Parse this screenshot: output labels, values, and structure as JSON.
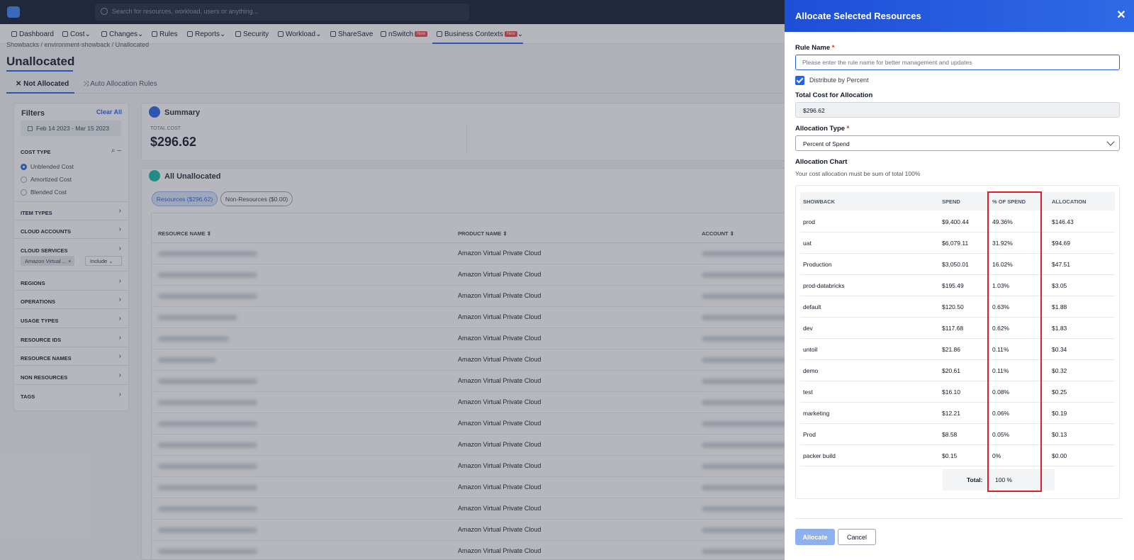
{
  "app": {
    "search_placeholder": "Search for resources, workload, users or anything..."
  },
  "nav": {
    "items": [
      {
        "label": "Dashboard",
        "icon": "grid-icon"
      },
      {
        "label": "Cost",
        "icon": "dollar-icon",
        "caret": "⌄"
      },
      {
        "label": "Changes",
        "icon": "list-icon",
        "caret": "⌄"
      },
      {
        "label": "Rules",
        "icon": "rules-icon"
      },
      {
        "label": "Reports",
        "icon": "report-icon",
        "caret": "⌄"
      },
      {
        "label": "Security",
        "icon": "lock-icon"
      },
      {
        "label": "Workload",
        "icon": "cube-icon",
        "caret": "⌄"
      },
      {
        "label": "ShareSave",
        "icon": "share-icon"
      },
      {
        "label": "nSwitch",
        "icon": "switch-icon",
        "badge": "New"
      },
      {
        "label": "Business Contexts",
        "icon": "people-icon",
        "badge": "New",
        "caret": "⌄"
      }
    ]
  },
  "breadcrumb": "Showbacks  /  environment-showback  /  Unallocated",
  "page_title": "Unallocated",
  "tabs": {
    "not_allocated": "Not Allocated",
    "auto_rules": "Auto Allocation Rules"
  },
  "filters": {
    "title": "Filters",
    "clear_all": "Clear All",
    "date_range": "Feb 14 2023    -  Mar 15 2023",
    "cost_type_label": "COST TYPE",
    "cost_types": [
      "Unblended Cost",
      "Amortized Cost",
      "Blended Cost"
    ],
    "sections": [
      "ITEM TYPES",
      "CLOUD ACCOUNTS",
      "CLOUD SERVICES",
      "REGIONS",
      "OPERATIONS",
      "USAGE TYPES",
      "RESOURCE IDS",
      "RESOURCE NAMES",
      "NON RESOURCES",
      "TAGS"
    ],
    "chip": "Amazon Virtual ...",
    "include": "Include"
  },
  "summary": {
    "title": "Summary",
    "total_cost_label": "TOTAL COST",
    "total_cost_value": "$296.62"
  },
  "all_unallocated": {
    "title": "All Unallocated",
    "pill_resources": "Resources ($296.62)",
    "pill_non_resources": "Non-Resources ($0.00)",
    "col_resource": "RESOURCE NAME",
    "col_product": "PRODUCT NAME",
    "col_account": "ACCOUNT",
    "product_value": "Amazon Virtual Private Cloud"
  },
  "drawer": {
    "title": "Allocate Selected Resources",
    "close": "✕",
    "rule_name_label": "Rule Name",
    "rule_name_placeholder": "Please enter the rule name for better management and updates",
    "required_mark": "*",
    "distribute_label": "Distribute by Percent",
    "total_cost_label": "Total Cost for Allocation",
    "total_cost_value": "$296.62",
    "allocation_type_label": "Allocation Type",
    "allocation_type_value": "Percent of Spend",
    "chart_label": "Allocation Chart",
    "chart_note": "Your cost allocation must be sum of total 100%",
    "table": {
      "headers": [
        "SHOWBACK",
        "SPEND",
        "% OF SPEND",
        "ALLOCATION"
      ],
      "rows": [
        [
          "prod",
          "$9,400.44",
          "49.36%",
          "$146.43"
        ],
        [
          "uat",
          "$6,079.11",
          "31.92%",
          "$94.69"
        ],
        [
          "Production",
          "$3,050.01",
          "16.02%",
          "$47.51"
        ],
        [
          "prod-databricks",
          "$195.49",
          "1.03%",
          "$3.05"
        ],
        [
          "default",
          "$120.50",
          "0.63%",
          "$1.88"
        ],
        [
          "dev",
          "$117.68",
          "0.62%",
          "$1.83"
        ],
        [
          "untoil",
          "$21.86",
          "0.11%",
          "$0.34"
        ],
        [
          "demo",
          "$20.61",
          "0.11%",
          "$0.32"
        ],
        [
          "test",
          "$16.10",
          "0.08%",
          "$0.25"
        ],
        [
          "marketing",
          "$12.21",
          "0.06%",
          "$0.19"
        ],
        [
          "Prod",
          "$8.58",
          "0.05%",
          "$0.13"
        ],
        [
          "packer build",
          "$0.15",
          "0%",
          "$0.00"
        ]
      ],
      "total_label": "Total:",
      "total_value": "100 %"
    },
    "allocate_button": "Allocate",
    "cancel_button": "Cancel"
  }
}
